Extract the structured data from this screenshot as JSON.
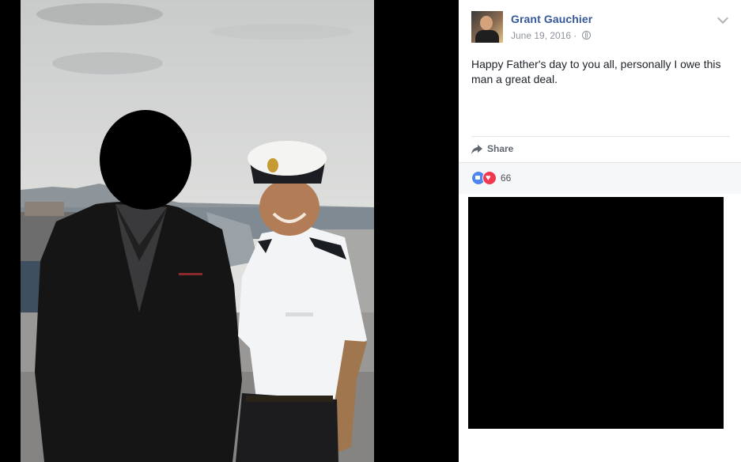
{
  "post": {
    "author": "Grant Gauchier",
    "date": "June 19, 2016 · ",
    "privacy_icon": "globe-icon",
    "text": "Happy Father's day to you all, personally I owe this man a great deal.",
    "options_icon": "chevron-down-icon"
  },
  "actions": {
    "share_label": "Share",
    "share_icon": "share-arrow-icon"
  },
  "reactions": {
    "types": [
      "like",
      "love"
    ],
    "count": "66"
  },
  "colors": {
    "author_link": "#365899",
    "meta_gray": "#90949c",
    "like_blue": "#4e86f0",
    "love_red": "#f0384e",
    "redaction": "#000000"
  }
}
